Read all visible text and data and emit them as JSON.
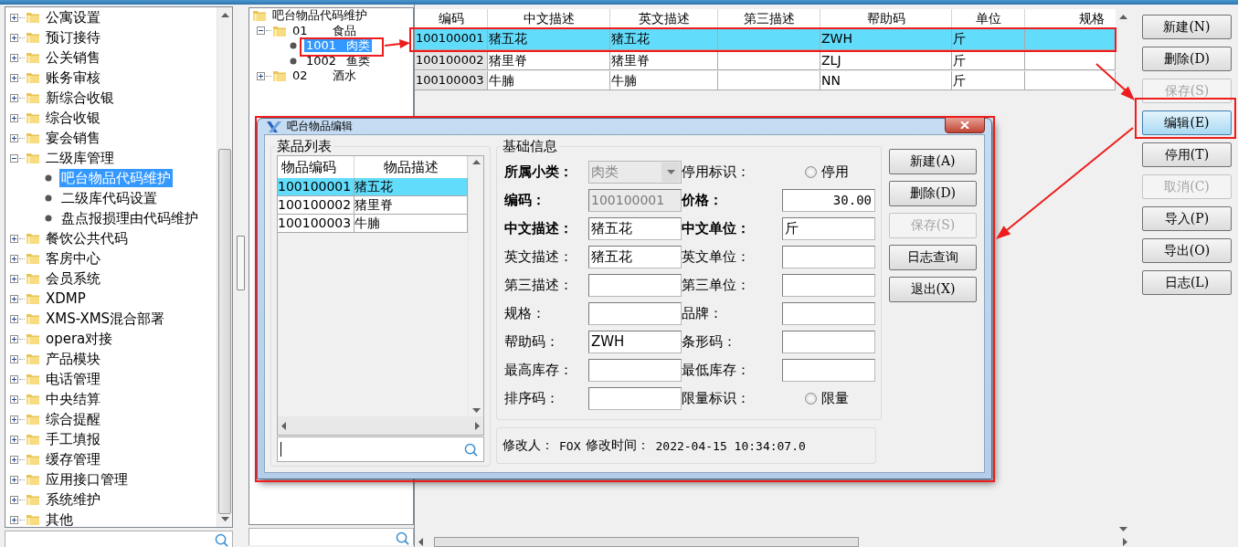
{
  "nav_tree": {
    "items": [
      {
        "label": "公寓设置",
        "expanded": false,
        "selected": false
      },
      {
        "label": "预订接待",
        "expanded": false,
        "selected": false
      },
      {
        "label": "公关销售",
        "expanded": false,
        "selected": false
      },
      {
        "label": "账务审核",
        "expanded": false,
        "selected": false
      },
      {
        "label": "新综合收银",
        "expanded": false,
        "selected": false
      },
      {
        "label": "综合收银",
        "expanded": false,
        "selected": false
      },
      {
        "label": "宴会销售",
        "expanded": false,
        "selected": false
      },
      {
        "label": "二级库管理",
        "expanded": true,
        "selected": false,
        "children": [
          {
            "label": "吧台物品代码维护",
            "selected": true
          },
          {
            "label": "二级库代码设置",
            "selected": false
          },
          {
            "label": "盘点报损理由代码维护",
            "selected": false
          }
        ]
      },
      {
        "label": "餐饮公共代码",
        "expanded": false,
        "selected": false
      },
      {
        "label": "客房中心",
        "expanded": false,
        "selected": false
      },
      {
        "label": "会员系统",
        "expanded": false,
        "selected": false
      },
      {
        "label": "XDMP",
        "expanded": false,
        "selected": false
      },
      {
        "label": "XMS-XMS混合部署",
        "expanded": false,
        "selected": false
      },
      {
        "label": "opera对接",
        "expanded": false,
        "selected": false
      },
      {
        "label": "产品模块",
        "expanded": false,
        "selected": false
      },
      {
        "label": "电话管理",
        "expanded": false,
        "selected": false
      },
      {
        "label": "中央结算",
        "expanded": false,
        "selected": false
      },
      {
        "label": "综合提醒",
        "expanded": false,
        "selected": false
      },
      {
        "label": "手工填报",
        "expanded": false,
        "selected": false
      },
      {
        "label": "缓存管理",
        "expanded": false,
        "selected": false
      },
      {
        "label": "应用接口管理",
        "expanded": false,
        "selected": false
      },
      {
        "label": "系统维护",
        "expanded": false,
        "selected": false
      },
      {
        "label": "其他",
        "expanded": false,
        "selected": false
      }
    ]
  },
  "category_tree": {
    "label": "吧台物品代码维护",
    "children": [
      {
        "code": "01",
        "label": "食品",
        "expanded": true,
        "selected": false,
        "children": [
          {
            "code": "1001",
            "label": "肉类",
            "selected": true
          },
          {
            "code": "1002",
            "label": "鱼类",
            "selected": false
          }
        ]
      },
      {
        "code": "02",
        "label": "酒水",
        "expanded": false,
        "selected": false
      }
    ]
  },
  "table": {
    "columns": [
      "编码",
      "中文描述",
      "英文描述",
      "第三描述",
      "帮助码",
      "单位",
      "规格"
    ],
    "rows": [
      {
        "code": "100100001",
        "name_cn": "猪五花",
        "name_en": "猪五花",
        "help_code": "ZWH",
        "unit": "斤",
        "selected": true
      },
      {
        "code": "100100002",
        "name_cn": "猪里脊",
        "name_en": "猪里脊",
        "help_code": "ZLJ",
        "unit": "斤",
        "selected": false
      },
      {
        "code": "100100003",
        "name_cn": "牛腩",
        "name_en": "牛腩",
        "help_code": "NN",
        "unit": "斤",
        "selected": false
      }
    ]
  },
  "buttons": [
    {
      "label": "新建(N)",
      "disabled": false,
      "focused": false
    },
    {
      "label": "删除(D)",
      "disabled": false,
      "focused": false
    },
    {
      "label": "保存(S)",
      "disabled": true,
      "focused": false
    },
    {
      "label": "编辑(E)",
      "disabled": false,
      "focused": true
    },
    {
      "label": "停用(T)",
      "disabled": false,
      "focused": false
    },
    {
      "label": "取消(C)",
      "disabled": true,
      "focused": false
    },
    {
      "label": "导入(P)",
      "disabled": false,
      "focused": false
    },
    {
      "label": "导出(O)",
      "disabled": false,
      "focused": false
    },
    {
      "label": "日志(L)",
      "disabled": false,
      "focused": false
    }
  ],
  "dialog": {
    "title": "吧台物品编辑",
    "item_list": {
      "title": "菜品列表",
      "columns": [
        "物品编码",
        "物品描述"
      ],
      "rows": [
        {
          "code": "100100001",
          "name": "猪五花",
          "selected": true
        },
        {
          "code": "100100002",
          "name": "猪里脊",
          "selected": false
        },
        {
          "code": "100100003",
          "name": "牛腩",
          "selected": false
        }
      ]
    },
    "basic_info": {
      "title": "基础信息",
      "fields": [
        {
          "label": "所属小类：",
          "bold": true,
          "kind": "dropdown",
          "value": "肉类",
          "disabled": true
        },
        {
          "label": "停用标识：",
          "bold": false,
          "kind": "radio",
          "option": "停用",
          "checked": false
        },
        {
          "label": "编码：",
          "bold": true,
          "kind": "text",
          "value": "100100001",
          "disabled": true
        },
        {
          "label": "价格：",
          "bold": true,
          "kind": "number",
          "value": "30.00",
          "disabled": false
        },
        {
          "label": "中文描述：",
          "bold": true,
          "kind": "text",
          "value": "猪五花",
          "disabled": false
        },
        {
          "label": "中文单位：",
          "bold": true,
          "kind": "text",
          "value": "斤",
          "disabled": false
        },
        {
          "label": "英文描述：",
          "bold": false,
          "kind": "text",
          "value": "猪五花",
          "disabled": false
        },
        {
          "label": "英文单位：",
          "bold": false,
          "kind": "text",
          "disabled": false
        },
        {
          "label": "第三描述：",
          "bold": false,
          "kind": "text",
          "disabled": false
        },
        {
          "label": "第三单位：",
          "bold": false,
          "kind": "text",
          "disabled": false
        },
        {
          "label": "规格：",
          "bold": false,
          "kind": "text",
          "disabled": false
        },
        {
          "label": "品牌：",
          "bold": false,
          "kind": "text",
          "disabled": false
        },
        {
          "label": "帮助码：",
          "bold": false,
          "kind": "text",
          "value": "ZWH",
          "disabled": false
        },
        {
          "label": "条形码：",
          "bold": false,
          "kind": "text",
          "disabled": false
        },
        {
          "label": "最高库存：",
          "bold": false,
          "kind": "text",
          "disabled": false
        },
        {
          "label": "最低库存：",
          "bold": false,
          "kind": "text",
          "disabled": false
        },
        {
          "label": "排序码：",
          "bold": false,
          "kind": "text",
          "disabled": false
        },
        {
          "label": "限量标识：",
          "bold": false,
          "kind": "radio",
          "option": "限量",
          "checked": false
        }
      ]
    },
    "footer": {
      "modified_by_label": "修改人：",
      "modified_by": "FOX",
      "modified_time_label": "修改时间：",
      "modified_time": "2022-04-15 10:34:07.0"
    },
    "buttons": [
      {
        "label": "新建(A)",
        "disabled": false
      },
      {
        "label": "删除(D)",
        "disabled": false
      },
      {
        "label": "保存(S)",
        "disabled": true
      },
      {
        "label": "日志查询",
        "disabled": false
      },
      {
        "label": "退出(X)",
        "disabled": false
      }
    ]
  }
}
